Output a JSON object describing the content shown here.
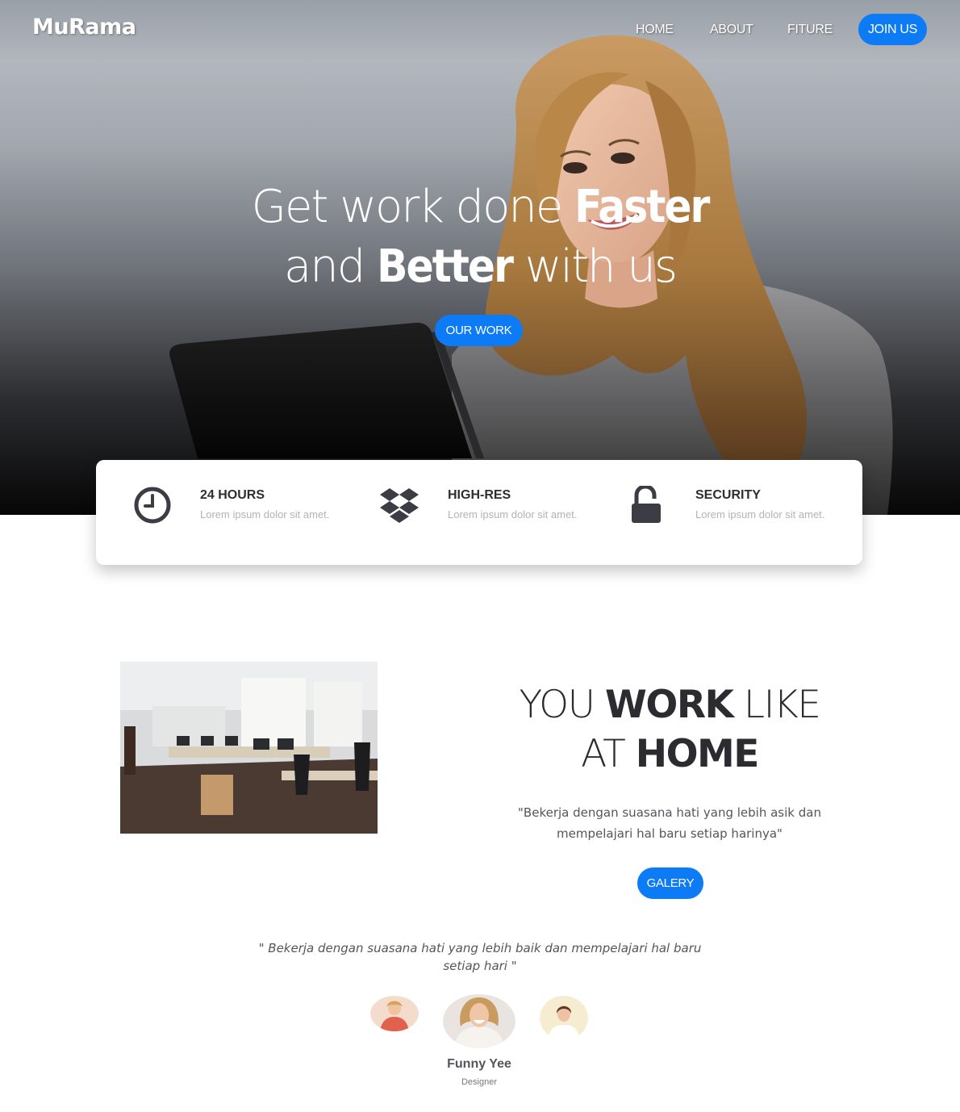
{
  "brand": "MuRama",
  "nav": {
    "items": [
      "HOME",
      "ABOUT",
      "FITURE"
    ],
    "cta": "JOIN US"
  },
  "hero": {
    "line1_light": "Get work done ",
    "line1_bold": "Faster",
    "line2_light_a": "and ",
    "line2_bold": "Better",
    "line2_light_b": " with us",
    "button": "OUR WORK"
  },
  "features": [
    {
      "icon": "clock-icon",
      "title": "24 HOURS",
      "desc": "Lorem ipsum dolor sit amet."
    },
    {
      "icon": "dropbox-icon",
      "title": "HIGH-RES",
      "desc": "Lorem ipsum dolor sit amet."
    },
    {
      "icon": "unlock-icon",
      "title": "SECURITY",
      "desc": "Lorem ipsum dolor sit amet."
    }
  ],
  "about": {
    "title_a": "YOU ",
    "title_b": "WORK",
    "title_c": " LIKE",
    "title_d": "AT ",
    "title_e": "HOME",
    "quote": "\"Bekerja dengan suasana hati yang lebih asik dan mempelajari hal baru setiap harinya\"",
    "button": "GALERY"
  },
  "testimonial": {
    "quote": "\" Bekerja dengan suasana hati yang lebih baik dan mempelajari hal baru setiap hari \"",
    "name": "Funny Yee",
    "role": "Designer"
  },
  "colors": {
    "accent": "#0d7bf5",
    "heading": "#2b2b30",
    "muted": "#b3b3b8"
  }
}
